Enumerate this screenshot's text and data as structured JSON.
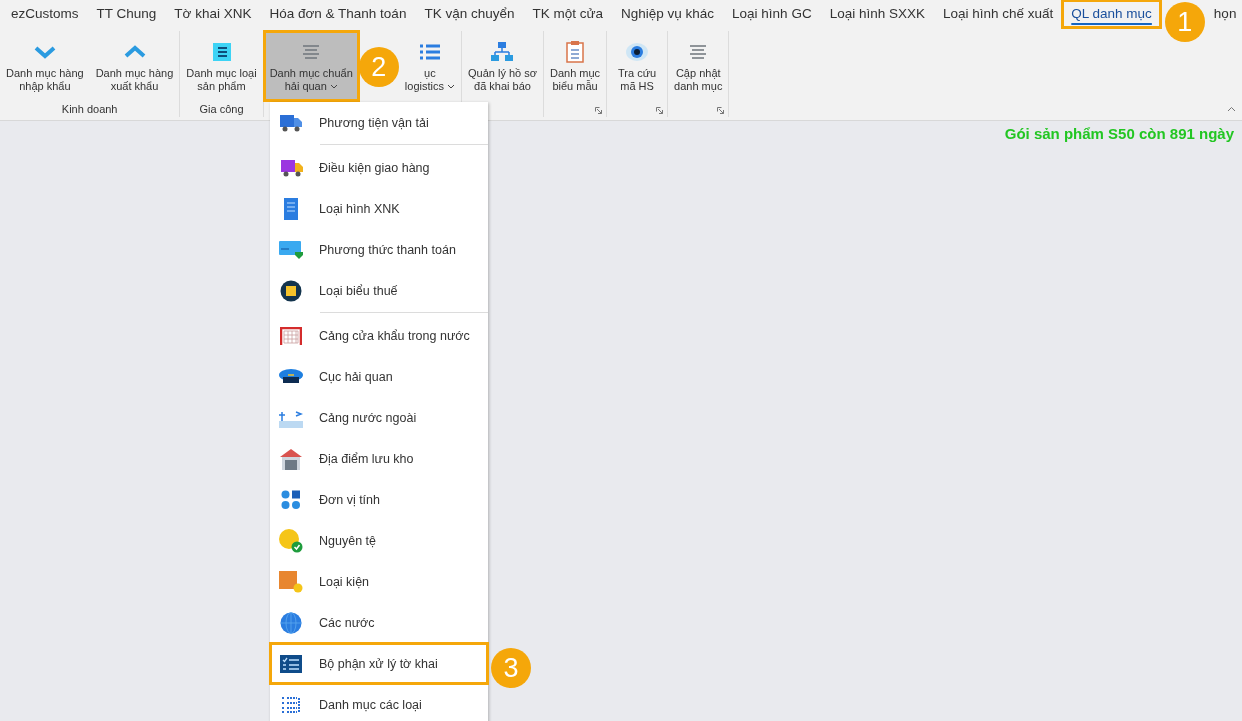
{
  "tabs": [
    {
      "label": "ezCustoms",
      "selected": false
    },
    {
      "label": "TT Chung",
      "selected": false
    },
    {
      "label": "Tờ khai XNK",
      "selected": false
    },
    {
      "label": "Hóa đơn & Thanh toán",
      "selected": false
    },
    {
      "label": "TK vận chuyển",
      "selected": false
    },
    {
      "label": "TK một cửa",
      "selected": false
    },
    {
      "label": "Nghiệp vụ khác",
      "selected": false
    },
    {
      "label": "Loại hình GC",
      "selected": false
    },
    {
      "label": "Loại hình SXXK",
      "selected": false
    },
    {
      "label": "Loại hình chế xuất",
      "selected": false
    },
    {
      "label": "QL danh mục",
      "selected": true,
      "callout": "1"
    },
    {
      "label": "họn",
      "selected": false
    }
  ],
  "ribbon": {
    "groups": [
      {
        "label": "Kinh doanh",
        "launcher": false,
        "buttons": [
          {
            "lines": [
              "Danh mục hàng",
              "nhập khẩu"
            ],
            "dropdown": false,
            "pressed": false
          },
          {
            "lines": [
              "Danh mục hàng",
              "xuất khẩu"
            ],
            "dropdown": false,
            "pressed": false
          }
        ]
      },
      {
        "label": "Gia công",
        "launcher": false,
        "buttons": [
          {
            "lines": [
              "Danh mục loại",
              "sản phẩm"
            ],
            "dropdown": false,
            "pressed": false
          }
        ]
      },
      {
        "launcher": false,
        "buttons": [
          {
            "lines": [
              "Danh mục chuẩn",
              "hải quan"
            ],
            "dropdown": true,
            "pressed": true,
            "callout": "2"
          },
          {
            "lines": [
              "ục",
              "logistics"
            ],
            "dropdown": true,
            "pressed": false
          }
        ]
      },
      {
        "launcher": false,
        "buttons": [
          {
            "lines": [
              "Quản lý hồ sơ",
              "đã khai báo"
            ],
            "dropdown": false,
            "pressed": false
          }
        ]
      },
      {
        "launcher": true,
        "buttons": [
          {
            "lines": [
              "Danh mục",
              "biểu mẫu"
            ],
            "dropdown": false,
            "pressed": false
          }
        ]
      },
      {
        "launcher": true,
        "buttons": [
          {
            "lines": [
              "Tra cứu",
              "mã HS"
            ],
            "dropdown": false,
            "pressed": false
          }
        ]
      },
      {
        "launcher": true,
        "buttons": [
          {
            "lines": [
              "Cập nhật",
              "danh mục"
            ],
            "dropdown": false,
            "pressed": false
          }
        ]
      }
    ]
  },
  "status": "Gói sản phẩm S50 còn 891 ngày",
  "menu": {
    "items": [
      {
        "label": "Phương tiện vận tải",
        "separator_after": true
      },
      {
        "label": "Điều kiện giao hàng",
        "separator_after": false
      },
      {
        "label": "Loại hình XNK",
        "separator_after": false
      },
      {
        "label": "Phương thức thanh toán",
        "separator_after": false
      },
      {
        "label": "Loại biểu thuế",
        "separator_after": true
      },
      {
        "label": "Cảng cửa khẩu trong nước",
        "separator_after": false
      },
      {
        "label": "Cục hải quan",
        "separator_after": false
      },
      {
        "label": "Cảng nước ngoài",
        "separator_after": false
      },
      {
        "label": "Địa điểm lưu kho",
        "separator_after": false
      },
      {
        "label": "Đơn vị tính",
        "separator_after": false
      },
      {
        "label": "Nguyên tệ",
        "separator_after": false
      },
      {
        "label": "Loại kiện",
        "separator_after": false
      },
      {
        "label": "Các nước",
        "separator_after": false
      },
      {
        "label": "Bộ phận xử lý tờ khai",
        "separator_after": false,
        "callout": "3"
      },
      {
        "label": "Danh mục các loại",
        "separator_after": false
      }
    ]
  }
}
